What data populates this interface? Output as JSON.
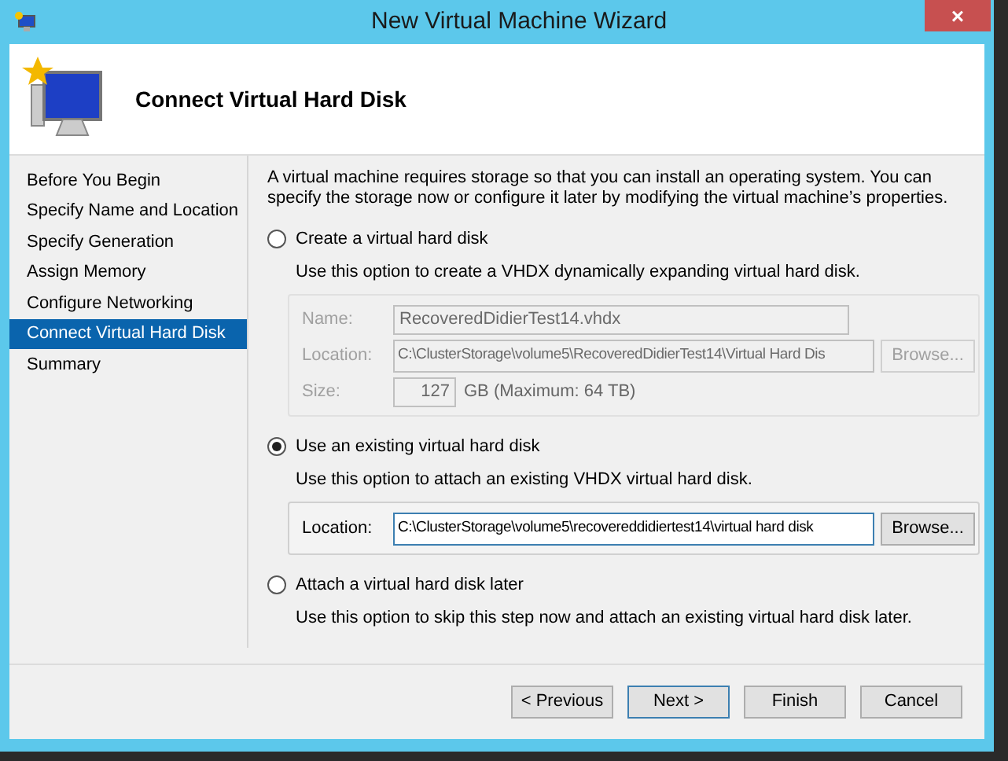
{
  "window": {
    "title": "New Virtual Machine Wizard",
    "close": "×"
  },
  "header": {
    "title": "Connect Virtual Hard Disk"
  },
  "steps": [
    {
      "label": "Before You Begin",
      "selected": false
    },
    {
      "label": "Specify Name and Location",
      "selected": false
    },
    {
      "label": "Specify Generation",
      "selected": false
    },
    {
      "label": "Assign Memory",
      "selected": false
    },
    {
      "label": "Configure Networking",
      "selected": false
    },
    {
      "label": "Connect Virtual Hard Disk",
      "selected": true
    },
    {
      "label": "Summary",
      "selected": false
    }
  ],
  "intro": "A virtual machine requires storage so that you can install an operating system. You can specify the storage now or configure it later by modifying the virtual machine’s properties.",
  "options": [
    {
      "label": "Create a virtual hard disk",
      "selected": false,
      "description": "Use this option to create a VHDX dynamically expanding virtual hard disk.",
      "disabled": true,
      "fields": [
        {
          "kind": "text",
          "label": "Name:",
          "value": "RecoveredDidierTest14.vhdx"
        },
        {
          "kind": "path",
          "label": "Location:",
          "value": "C:\\ClusterStorage\\volume5\\RecoveredDidierTest14\\Virtual Hard Dis",
          "button": "Browse..."
        },
        {
          "kind": "size",
          "label": "Size:",
          "value": "127",
          "suffix": "GB (Maximum: 64 TB)"
        }
      ]
    },
    {
      "label": "Use an existing virtual hard disk",
      "selected": true,
      "description": "Use this option to attach an existing VHDX virtual hard disk.",
      "disabled": false,
      "fields": [
        {
          "kind": "path",
          "label": "Location:",
          "value": "C:\\ClusterStorage\\volume5\\recovereddidiertest14\\virtual hard disk",
          "button": "Browse..."
        }
      ]
    },
    {
      "label": "Attach a virtual hard disk later",
      "selected": false,
      "description": "Use this option to skip this step now and attach an existing virtual hard disk later."
    }
  ],
  "buttons": [
    {
      "label": "< Previous",
      "default": false
    },
    {
      "label": "Next >",
      "default": true
    },
    {
      "label": "Finish",
      "default": false
    },
    {
      "label": "Cancel",
      "default": false
    }
  ]
}
